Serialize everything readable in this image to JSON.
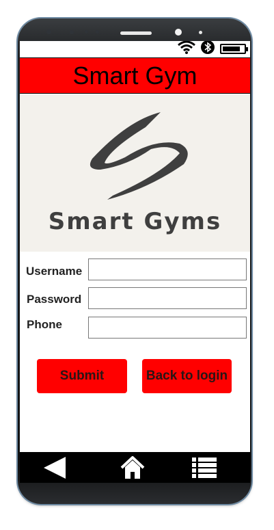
{
  "app": {
    "title": "Smart Gym",
    "logo_text": "Smart Gyms"
  },
  "status_bar": {
    "icons": [
      "wifi-icon",
      "bluetooth-icon",
      "battery-icon"
    ],
    "battery_level": 0.85
  },
  "form": {
    "username_label": "Username",
    "password_label": "Password",
    "phone_label": "Phone",
    "username_value": "",
    "password_value": "",
    "phone_value": ""
  },
  "buttons": {
    "submit_label": "Submit",
    "back_label": "Back to login"
  },
  "nav": {
    "icons": [
      "back-icon",
      "home-icon",
      "menu-icon"
    ]
  },
  "colors": {
    "accent": "#ff0000",
    "logo_background": "#f3f1ec",
    "logo_mark": "#3f3f3f",
    "nav_background": "#000000"
  }
}
